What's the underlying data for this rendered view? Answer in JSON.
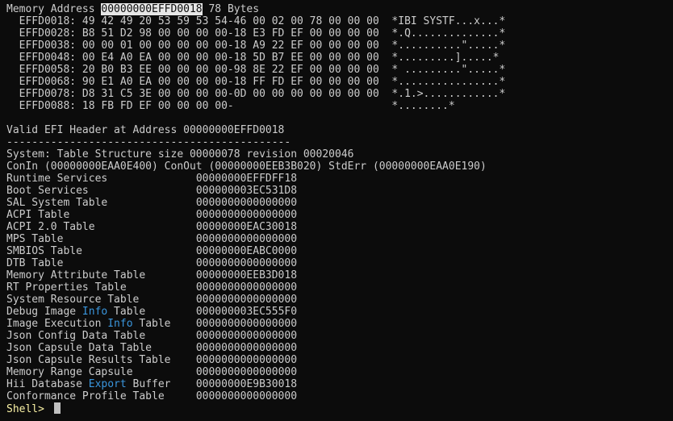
{
  "dump": {
    "memory_label": "Memory Address ",
    "address": "00000000EFFD0018",
    "bytes_label": " 78 Bytes",
    "rows": [
      "  EFFD0018: 49 42 49 20 53 59 53 54-46 00 02 00 78 00 00 00  *IBI SYSTF...x...*",
      "  EFFD0028: B8 51 D2 98 00 00 00 00-18 E3 FD EF 00 00 00 00  *.Q..............*",
      "  EFFD0038: 00 00 01 00 00 00 00 00-18 A9 22 EF 00 00 00 00  *..........\".....*",
      "  EFFD0048: 00 E4 A0 EA 00 00 00 00-18 5D B7 EE 00 00 00 00  *.........].....*",
      "  EFFD0058: 20 B0 B3 EE 00 00 00 00-98 8E 22 EF 00 00 00 00  * .........\".....*",
      "  EFFD0068: 90 E1 A0 EA 00 00 00 00-18 FF FD EF 00 00 00 00  *................*",
      "  EFFD0078: D8 31 C5 3E 00 00 00 00-0D 00 00 00 00 00 00 00  *.1.>............*",
      "  EFFD0088: 18 FB FD EF 00 00 00 00-                         *........*"
    ]
  },
  "header": {
    "valid_line": "Valid EFI Header at Address 00000000EFFD0018",
    "separator": "---------------------------------------------",
    "system_line": "System: Table Structure size 00000078 revision 00020046",
    "con_line": "ConIn (00000000EAA0E400) ConOut (00000000EEB3B020) StdErr (00000000EAA0E190)"
  },
  "tables": [
    {
      "pre": "Runtime Services",
      "kw": "",
      "post": "",
      "value": "00000000EFFDFF18"
    },
    {
      "pre": "Boot Services",
      "kw": "",
      "post": "",
      "value": "000000003EC531D8"
    },
    {
      "pre": "SAL System Table",
      "kw": "",
      "post": "",
      "value": "0000000000000000"
    },
    {
      "pre": "ACPI Table",
      "kw": "",
      "post": "",
      "value": "0000000000000000"
    },
    {
      "pre": "ACPI 2.0 Table",
      "kw": "",
      "post": "",
      "value": "00000000EAC30018"
    },
    {
      "pre": "MPS Table",
      "kw": "",
      "post": "",
      "value": "0000000000000000"
    },
    {
      "pre": "SMBIOS Table",
      "kw": "",
      "post": "",
      "value": "00000000EABC0000"
    },
    {
      "pre": "DTB Table",
      "kw": "",
      "post": "",
      "value": "0000000000000000"
    },
    {
      "pre": "Memory Attribute Table",
      "kw": "",
      "post": "",
      "value": "00000000EEB3D018"
    },
    {
      "pre": "RT Properties Table",
      "kw": "",
      "post": "",
      "value": "0000000000000000"
    },
    {
      "pre": "System Resource Table",
      "kw": "",
      "post": "",
      "value": "0000000000000000"
    },
    {
      "pre": "Debug Image ",
      "kw": "Info",
      "post": " Table",
      "value": "000000003EC555F0"
    },
    {
      "pre": "Image Execution ",
      "kw": "Info",
      "post": " Table",
      "value": "0000000000000000"
    },
    {
      "pre": "Json Config Data Table",
      "kw": "",
      "post": "",
      "value": "0000000000000000"
    },
    {
      "pre": "Json Capsule Data Table",
      "kw": "",
      "post": "",
      "value": "0000000000000000"
    },
    {
      "pre": "Json Capsule Results Table",
      "kw": "",
      "post": "",
      "value": "0000000000000000"
    },
    {
      "pre": "Memory Range Capsule",
      "kw": "",
      "post": "",
      "value": "0000000000000000"
    },
    {
      "pre": "Hii Database ",
      "kw": "Export",
      "post": " Buffer",
      "value": "00000000E9B30018"
    },
    {
      "pre": "Conformance Profile Table",
      "kw": "",
      "post": "",
      "value": "0000000000000000"
    }
  ],
  "prompt": "Shell> ",
  "colors": {
    "background": "#0c0c0c",
    "text": "#cccccc",
    "keyword": "#3a96dd",
    "prompt": "#f9f1a5",
    "highlight_bg": "#e6e6e6"
  }
}
